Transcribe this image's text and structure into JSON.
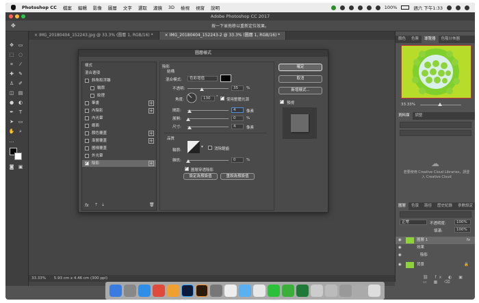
{
  "menubar": {
    "app": "Photoshop CC",
    "items": [
      "檔案",
      "編輯",
      "影像",
      "圖層",
      "文字",
      "選取",
      "濾鏡",
      "3D",
      "檢視",
      "視窗",
      "說明"
    ],
    "battery": "100%",
    "clock": "週六 下午1:33"
  },
  "window": {
    "title": "Adobe Photoshop CC 2017",
    "hint": "按一下並拖移以重新定位效果。"
  },
  "tabs": [
    {
      "label": "IMG_20180404_152243.jpg @ 33.3% (圖層 1, RGB/16) *"
    },
    {
      "label": "IMG_20180404_152243-2 @ 33.3% (圖層 1, RGB/16) *"
    }
  ],
  "status": {
    "zoom": "33.33%",
    "doc": "5.93 cm x 4.46 cm (300 ppi)"
  },
  "dialog": {
    "title": "圖層樣式",
    "list": [
      {
        "label": "樣式",
        "cb": false,
        "plus": false,
        "checked": false,
        "indent": 0
      },
      {
        "label": "混合選項",
        "cb": false,
        "plus": false,
        "checked": false,
        "indent": 0
      },
      {
        "label": "斜角和浮雕",
        "cb": true,
        "plus": false,
        "checked": false,
        "indent": 0
      },
      {
        "label": "輪廓",
        "cb": true,
        "plus": false,
        "checked": false,
        "indent": 1
      },
      {
        "label": "紋理",
        "cb": true,
        "plus": false,
        "checked": false,
        "indent": 1
      },
      {
        "label": "筆畫",
        "cb": true,
        "plus": true,
        "checked": false,
        "indent": 0
      },
      {
        "label": "內陰影",
        "cb": true,
        "plus": true,
        "checked": false,
        "indent": 0
      },
      {
        "label": "內光暈",
        "cb": true,
        "plus": false,
        "checked": false,
        "indent": 0
      },
      {
        "label": "緞面",
        "cb": true,
        "plus": false,
        "checked": false,
        "indent": 0
      },
      {
        "label": "顏色覆蓋",
        "cb": true,
        "plus": true,
        "checked": false,
        "indent": 0
      },
      {
        "label": "漸層覆蓋",
        "cb": true,
        "plus": true,
        "checked": false,
        "indent": 0
      },
      {
        "label": "圖樣覆蓋",
        "cb": true,
        "plus": false,
        "checked": false,
        "indent": 0
      },
      {
        "label": "外光暈",
        "cb": true,
        "plus": false,
        "checked": false,
        "indent": 0
      },
      {
        "label": "陰影",
        "cb": true,
        "plus": true,
        "checked": true,
        "indent": 0
      }
    ],
    "footer_fx": "fx",
    "section": "陰影",
    "subsection": "結構",
    "blend_label": "混合模式:",
    "blend_value": "色彩增值",
    "opacity_label": "不透明:",
    "opacity_value": "35",
    "pct": "%",
    "angle_label": "角度:",
    "angle_value": "130",
    "angle_unit": "°",
    "global_light": "使用整體光源",
    "distance_label": "間距:",
    "distance_value": "4",
    "spread_label": "展開:",
    "spread_value": "0",
    "size_label": "尺寸:",
    "size_value": "4",
    "px": "像素",
    "quality": "品質",
    "contour_label": "輪廓:",
    "antialias": "消除鋸齒",
    "noise_label": "雜訊:",
    "noise_value": "0",
    "knockout": "圖層穿透陰影",
    "default_btn": "設定為預設值",
    "reset_btn": "重設為預設值",
    "ok": "確定",
    "cancel": "取消",
    "new_style": "新增樣式...",
    "preview": "預視"
  },
  "panel": {
    "top_tabs": [
      "顏色",
      "色票",
      "導覽器",
      "色階分佈圖"
    ],
    "zoom": "33.33%",
    "lib_tabs": [
      "資料庫",
      "調整"
    ],
    "lib_text": "若要使用 Creative Cloud Libraries，請登入 Creative Cloud",
    "layer_tabs": [
      "圖層",
      "色版",
      "路徑",
      "歷史紀錄",
      "參數設定"
    ],
    "blend": "正常",
    "opacity": "不透明度:",
    "opacity_val": "100%",
    "fill_label": "填滿:",
    "fill_val": "100%",
    "layers": [
      {
        "name": "圖層 1",
        "fx": "fx"
      },
      {
        "name": "效果",
        "fx": ""
      },
      {
        "name": "陰影",
        "fx": ""
      },
      {
        "name": "背景",
        "fx": ""
      }
    ]
  }
}
